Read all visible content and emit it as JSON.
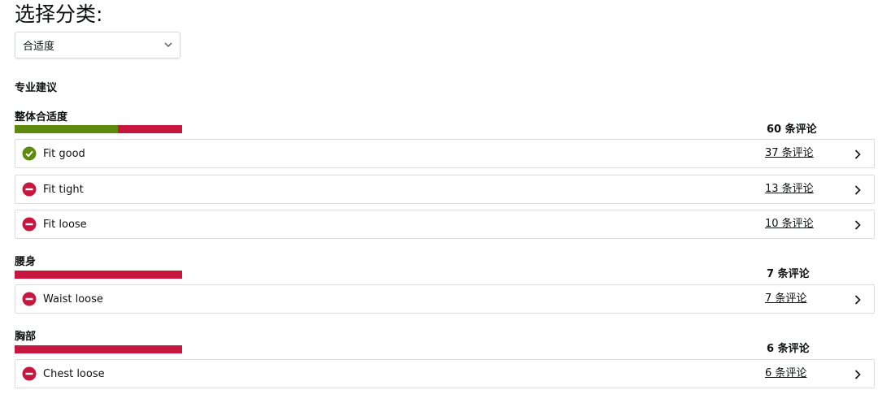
{
  "page_title": "选择分类:",
  "filter": {
    "selected": "合适度"
  },
  "section_title": "专业建议",
  "colors": {
    "good": "#5e8b0d",
    "bad": "#c7173f"
  },
  "groups": [
    {
      "title": "整体合适度",
      "total": "60 条评论",
      "good_fraction": 0.617,
      "items": [
        {
          "label": "Fit good",
          "count": "37 条评论",
          "status": "good",
          "icon": "check-circle-icon"
        },
        {
          "label": "Fit tight",
          "count": "13 条评论",
          "status": "bad",
          "icon": "minus-circle-icon"
        },
        {
          "label": "Fit loose",
          "count": "10 条评论",
          "status": "bad",
          "icon": "minus-circle-icon"
        }
      ]
    },
    {
      "title": "腰身",
      "total": "7 条评论",
      "good_fraction": 0,
      "items": [
        {
          "label": "Waist loose",
          "count": "7 条评论",
          "status": "bad",
          "icon": "minus-circle-icon"
        }
      ]
    },
    {
      "title": "胸部",
      "total": "6 条评论",
      "good_fraction": 0,
      "items": [
        {
          "label": "Chest loose",
          "count": "6 条评论",
          "status": "bad",
          "icon": "minus-circle-icon"
        }
      ]
    }
  ]
}
